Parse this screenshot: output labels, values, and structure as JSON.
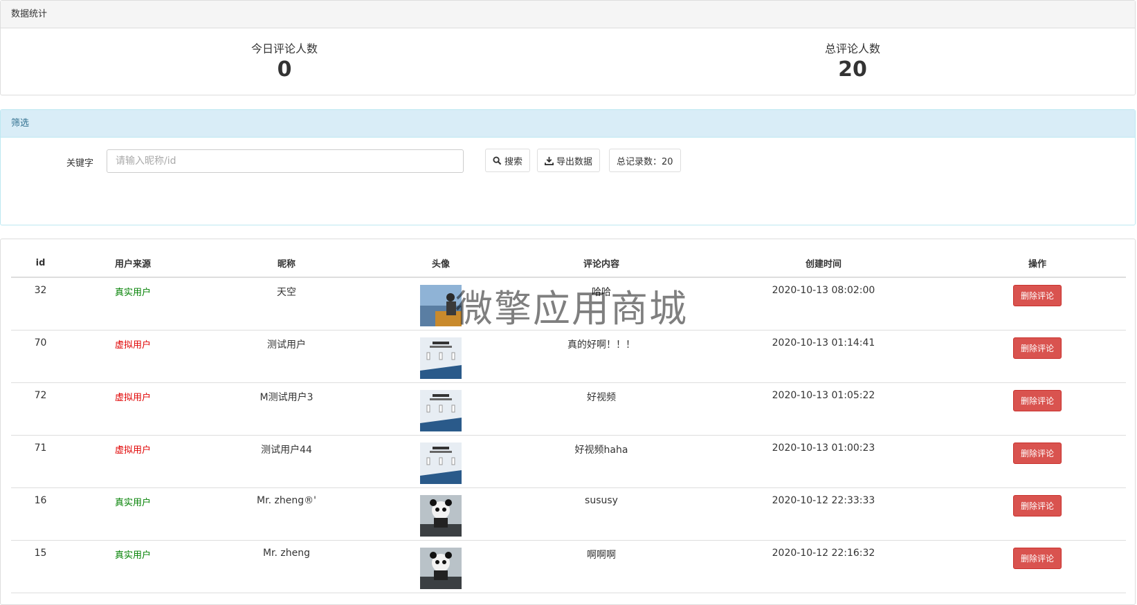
{
  "stats": {
    "title": "数据统计",
    "today_label": "今日评论人数",
    "today_value": "0",
    "total_label": "总评论人数",
    "total_value": "20"
  },
  "filter": {
    "title": "筛选",
    "keyword_label": "关键字",
    "keyword_placeholder": "请输入昵称/id",
    "keyword_value": "",
    "search_label": "搜索",
    "export_label": "导出数据",
    "total_records_label": "总记录数：20"
  },
  "table": {
    "headers": [
      "id",
      "用户来源",
      "昵称",
      "头像",
      "评论内容",
      "创建时间",
      "操作"
    ],
    "rows": [
      {
        "id": "32",
        "source": "真实用户",
        "nickname": "天空",
        "avatar": "person-photo",
        "content": "哈哈",
        "time": "2020-10-13 08:02:00",
        "action": "删除评论"
      },
      {
        "id": "70",
        "source": "虚拟用户",
        "nickname": "测试用户",
        "avatar": "product-ad",
        "content": "真的好啊！！！",
        "time": "2020-10-13 01:14:41",
        "action": "删除评论"
      },
      {
        "id": "72",
        "source": "虚拟用户",
        "nickname": "M测试用户3",
        "avatar": "product-ad",
        "content": "好视频",
        "time": "2020-10-13 01:05:22",
        "action": "删除评论"
      },
      {
        "id": "71",
        "source": "虚拟用户",
        "nickname": "测试用户44",
        "avatar": "product-ad",
        "content": "好视频haha",
        "time": "2020-10-13 01:00:23",
        "action": "删除评论"
      },
      {
        "id": "16",
        "source": "真实用户",
        "nickname": "Mr. zheng®'",
        "avatar": "panda-statue",
        "content": "sususy",
        "time": "2020-10-12 22:33:33",
        "action": "删除评论"
      },
      {
        "id": "15",
        "source": "真实用户",
        "nickname": "Mr. zheng",
        "avatar": "panda-statue",
        "content": "啊啊啊",
        "time": "2020-10-12 22:16:32",
        "action": "删除评论"
      }
    ]
  },
  "watermark": "微擎应用商城",
  "colors": {
    "real_user": "#008000",
    "virtual_user": "#e00000",
    "delete_button": "#d9534f"
  }
}
